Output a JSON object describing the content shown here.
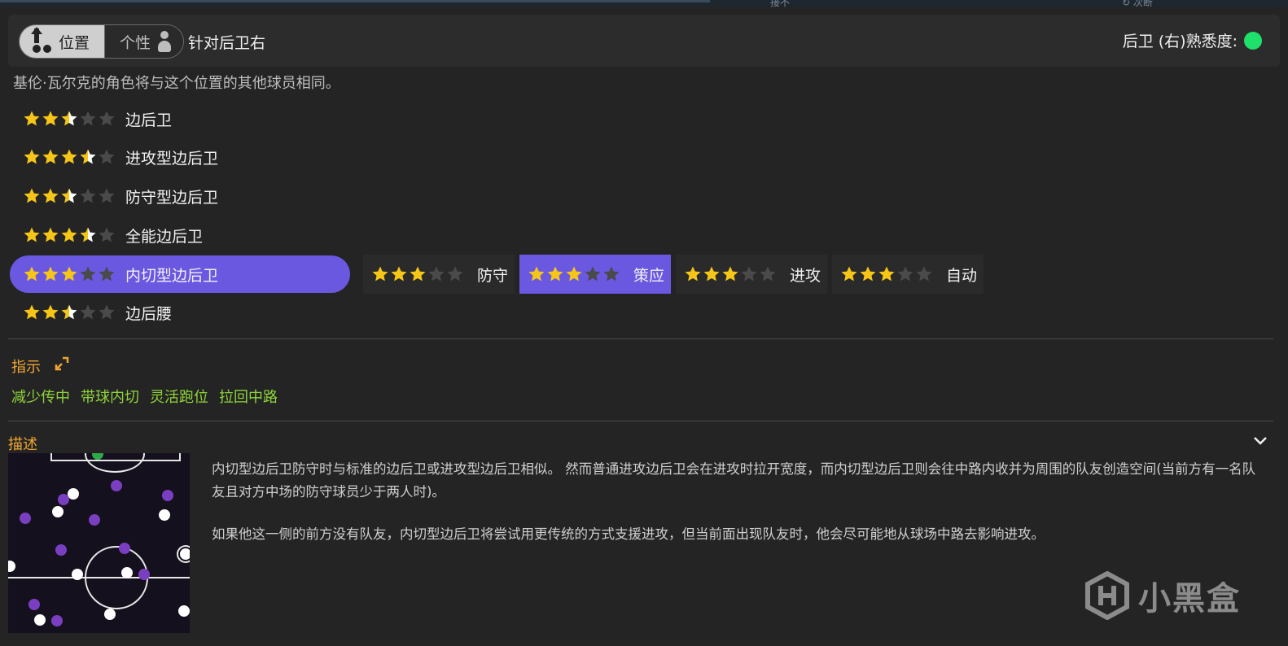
{
  "top_fragments": [
    "接不",
    "↻ 次断"
  ],
  "header": {
    "tab_position": "位置",
    "tab_personality": "个性",
    "target": "针对后卫右",
    "familiarity_label": "后卫 (右)熟悉度:",
    "familiarity_color": "#1fe06a"
  },
  "note": "基伦·瓦尔克的角色将与这个位置的其他球员相同。",
  "roles": [
    {
      "name": "边后卫",
      "rating": 2.5,
      "selected": false
    },
    {
      "name": "进攻型边后卫",
      "rating": 3.5,
      "selected": false
    },
    {
      "name": "防守型边后卫",
      "rating": 2.5,
      "selected": false
    },
    {
      "name": "全能边后卫",
      "rating": 3.5,
      "selected": false
    },
    {
      "name": "内切型边后卫",
      "rating": 3,
      "selected": true
    },
    {
      "name": "边后腰",
      "rating": 2.5,
      "selected": false
    }
  ],
  "duties": [
    {
      "name": "防守",
      "rating": 3,
      "selected": false
    },
    {
      "name": "策应",
      "rating": 3,
      "selected": true
    },
    {
      "name": "进攻",
      "rating": 3,
      "selected": false
    },
    {
      "name": "自动",
      "rating": 3,
      "selected": false
    }
  ],
  "instructions": {
    "title": "指示",
    "items": [
      "减少传中",
      "带球内切",
      "灵活跑位",
      "拉回中路"
    ]
  },
  "description": {
    "title": "描述",
    "paragraph1": "内切型边后卫防守时与标准的边后卫或进攻型边后卫相似。 然而普通进攻边后卫会在进攻时拉开宽度，而内切型边后卫则会往中路内收并为周围的队友创造空间(当前方有一名队友且对方中场的防守球员少于两人时)。",
    "paragraph2": "如果他这一侧的前方没有队友，内切型边后卫将尝试用更传统的方式支援进攻，但当前面出现队友时，他会尽可能地从球场中路去影响进攻。"
  },
  "watermark": "小黑盒",
  "colors": {
    "accent_purple": "#6b58e0",
    "star_gold": "#f5c518",
    "star_empty": "#4a4a4a",
    "section_orange": "#f0a532",
    "instruction_green": "#8fd43a"
  }
}
